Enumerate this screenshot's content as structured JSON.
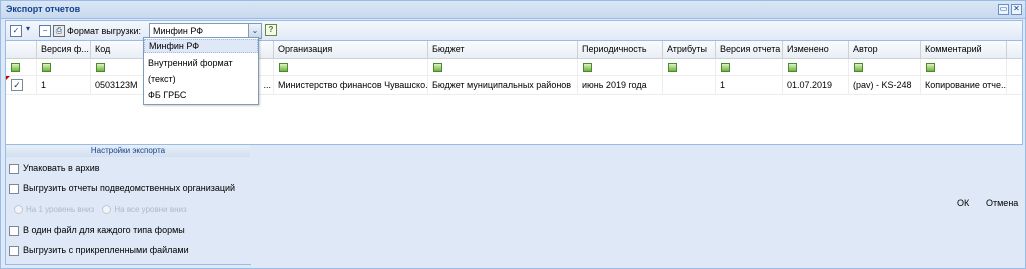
{
  "window": {
    "title": "Экспорт отчетов"
  },
  "toolbar": {
    "format_label": "Формат выгрузки:",
    "format_value": "Минфин РФ",
    "format_options": [
      "Минфин РФ",
      "Внутренний формат",
      "(текст)",
      "ФБ ГРБС"
    ]
  },
  "grid": {
    "columns": [
      "Версия ф...",
      "Код",
      "",
      "Организация",
      "Бюджет",
      "Периодичность",
      "Атрибуты",
      "Версия отчета",
      "Изменено",
      "Автор",
      "Комментарий"
    ],
    "row": {
      "checked": "✓",
      "version_form": "1",
      "code": "0503123M",
      "hidden": "...",
      "organization": "Министерство финансов Чувашско...",
      "budget": "Бюджет муниципальных районов",
      "period": "июнь 2019 года",
      "attributes": "",
      "report_version": "1",
      "modified": "01.07.2019",
      "author": "(pav) - KS-248",
      "comment": "Копирование отче..."
    }
  },
  "settings": {
    "header": "Настройки экспорта",
    "pack_archive": "Упаковать в архив",
    "export_subordinate": "Выгрузить отчеты подведомственных организаций",
    "radio_level1": "На 1 уровень вниз",
    "radio_all_levels": "На все уровни вниз",
    "one_file_per_type": "В один файл для каждого типа формы",
    "with_attachments": "Выгрузить с прикрепленными файлами"
  },
  "buttons": {
    "ok": "ОК",
    "cancel": "Отмена"
  }
}
